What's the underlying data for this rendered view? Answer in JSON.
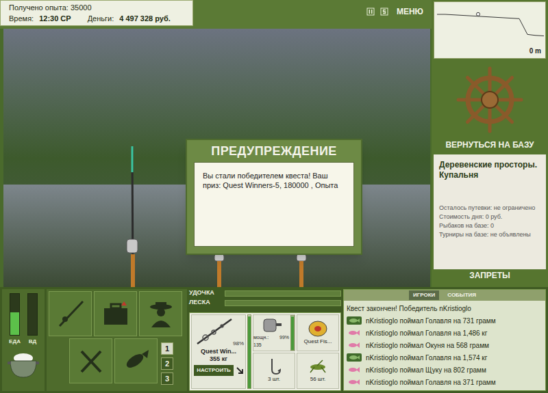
{
  "hud": {
    "experience": "Получено опыта: 35000",
    "time_label": "Время:",
    "time": "12:30 СР",
    "money_label": "Деньги:",
    "money": "4 497 328 руб."
  },
  "menu_button": "МЕНЮ",
  "dialog": {
    "title": "ПРЕДУПРЕЖДЕНИЕ",
    "message": "Вы стали победителем квеста! Ваш приз: Quest Winners-5, 180000 , Опыта"
  },
  "depth_chart": {
    "reading": "0 m",
    "depths": [
      1.0,
      1.0,
      1.05,
      1.1,
      1.15,
      1.2,
      1.25,
      1.3,
      1.35,
      1.4,
      1.45,
      3.1,
      3.2,
      3.25
    ],
    "marker_index": 5
  },
  "base": {
    "button": "ВЕРНУТЬСЯ НА БАЗУ",
    "name": "Деревенские просторы. Купальня",
    "details": [
      "Осталось путевки: не ограничено",
      "Стоимость дня: 0 руб.",
      "Рыбаков на базе: 0",
      "Турниры на базе: не объявлены"
    ],
    "bans_button": "ЗАПРЕТЫ"
  },
  "needs": [
    {
      "label": "ЕДА",
      "level": 0.55
    },
    {
      "label": "ВД",
      "level": 0
    }
  ],
  "rod_slots": [
    {
      "label": "1",
      "selected": true
    },
    {
      "label": "2",
      "selected": false
    },
    {
      "label": "3",
      "selected": false
    }
  ],
  "tension": [
    {
      "label": "УДОЧКА",
      "level": 0
    },
    {
      "label": "ЛЕСКА",
      "level": 0
    }
  ],
  "tackle": {
    "rod": {
      "name": "Quest Win...",
      "load": "355 кг",
      "condition": "98%",
      "level": 0.98
    },
    "setup_button": "НАСТРОИТЬ",
    "reel": {
      "power": "мощн.: 135",
      "condition": "99%",
      "level": 0.99
    },
    "line": {
      "name": "Quest Fis..."
    },
    "hook": {
      "count": "3 шт."
    },
    "bait": {
      "count": "56 шт."
    }
  },
  "log": {
    "tabs": [
      {
        "label": "ИГРОКИ",
        "selected": true
      },
      {
        "label": "СОБЫТИЯ",
        "selected": false
      }
    ],
    "header": "Квест закончен! Победитель nKristioglo",
    "entries": [
      {
        "text": "nKristioglo поймал Голавля на 731 грамм",
        "kind": "trophy"
      },
      {
        "text": "nKristioglo поймал Голавля на 1,486 кг",
        "kind": "regular"
      },
      {
        "text": "nKristioglo поймал Окуня на 568 грамм",
        "kind": "regular"
      },
      {
        "text": "nKristioglo поймал Голавля на 1,574 кг",
        "kind": "trophy"
      },
      {
        "text": "nKristioglo поймал Щуку на 802 грамм",
        "kind": "regular"
      },
      {
        "text": "nKristioglo поймал Голавля на 371 грамм",
        "kind": "regular"
      }
    ]
  }
}
